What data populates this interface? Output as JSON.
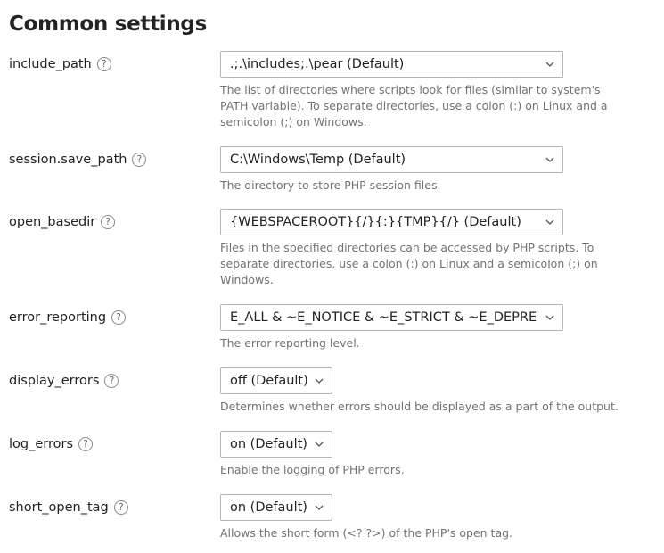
{
  "section": {
    "title": "Common settings"
  },
  "settings": [
    {
      "label": "include_path",
      "value": ".;.\\includes;.\\pear (Default)",
      "description": "The list of directories where scripts look for files (similar to system's PATH variable). To separate directories, use a colon (:) on Linux and a semicolon (;) on Windows."
    },
    {
      "label": "session.save_path",
      "value": "C:\\Windows\\Temp (Default)",
      "description": "The directory to store PHP session files."
    },
    {
      "label": "open_basedir",
      "value": "{WEBSPACEROOT}{/}{:}{TMP}{/} (Default)",
      "description": "Files in the specified directories can be accessed by PHP scripts. To separate directories, use a colon (:) on Linux and a semicolon (;) on Windows."
    },
    {
      "label": "error_reporting",
      "value": "E_ALL & ~E_NOTICE & ~E_STRICT & ~E_DEPRECATED",
      "description": "The error reporting level."
    },
    {
      "label": "display_errors",
      "value": "off (Default)",
      "description": "Determines whether errors should be displayed as a part of the output."
    },
    {
      "label": "log_errors",
      "value": "on (Default)",
      "description": "Enable the logging of PHP errors."
    },
    {
      "label": "short_open_tag",
      "value": "on (Default)",
      "description": "Allows the short form (<? ?>) of the PHP's open tag."
    }
  ],
  "icons": {
    "help": "?",
    "dropdown": "chevron-down-icon"
  },
  "colors": {
    "text": "#222222",
    "description": "#727272",
    "border": "#b5b5b5"
  }
}
